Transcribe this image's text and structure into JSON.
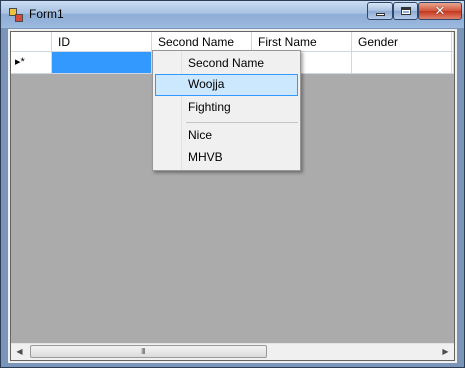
{
  "window": {
    "title": "Form1",
    "controls": {
      "minimize": "minimize",
      "maximize": "maximize",
      "close": "✕"
    }
  },
  "grid": {
    "columns": [
      "ID",
      "Second Name",
      "First Name",
      "Gender"
    ],
    "new_row_marker": "▸*",
    "scroll_grip": "III",
    "scroll_left": "◀",
    "scroll_right": "▶"
  },
  "dropdown": {
    "items": [
      "Second Name",
      "Woojja",
      "Fighting",
      "Nice",
      "MHVB"
    ],
    "highlighted": "Woojja"
  },
  "colors": {
    "selection": "#3399ff",
    "menu_highlight": "#cce8ff",
    "grid_background": "#ababab"
  },
  "icons": [
    "app-icon",
    "minimize-icon",
    "maximize-icon",
    "close-icon",
    "new-row-icon",
    "scroll-left-icon",
    "scroll-right-icon"
  ]
}
